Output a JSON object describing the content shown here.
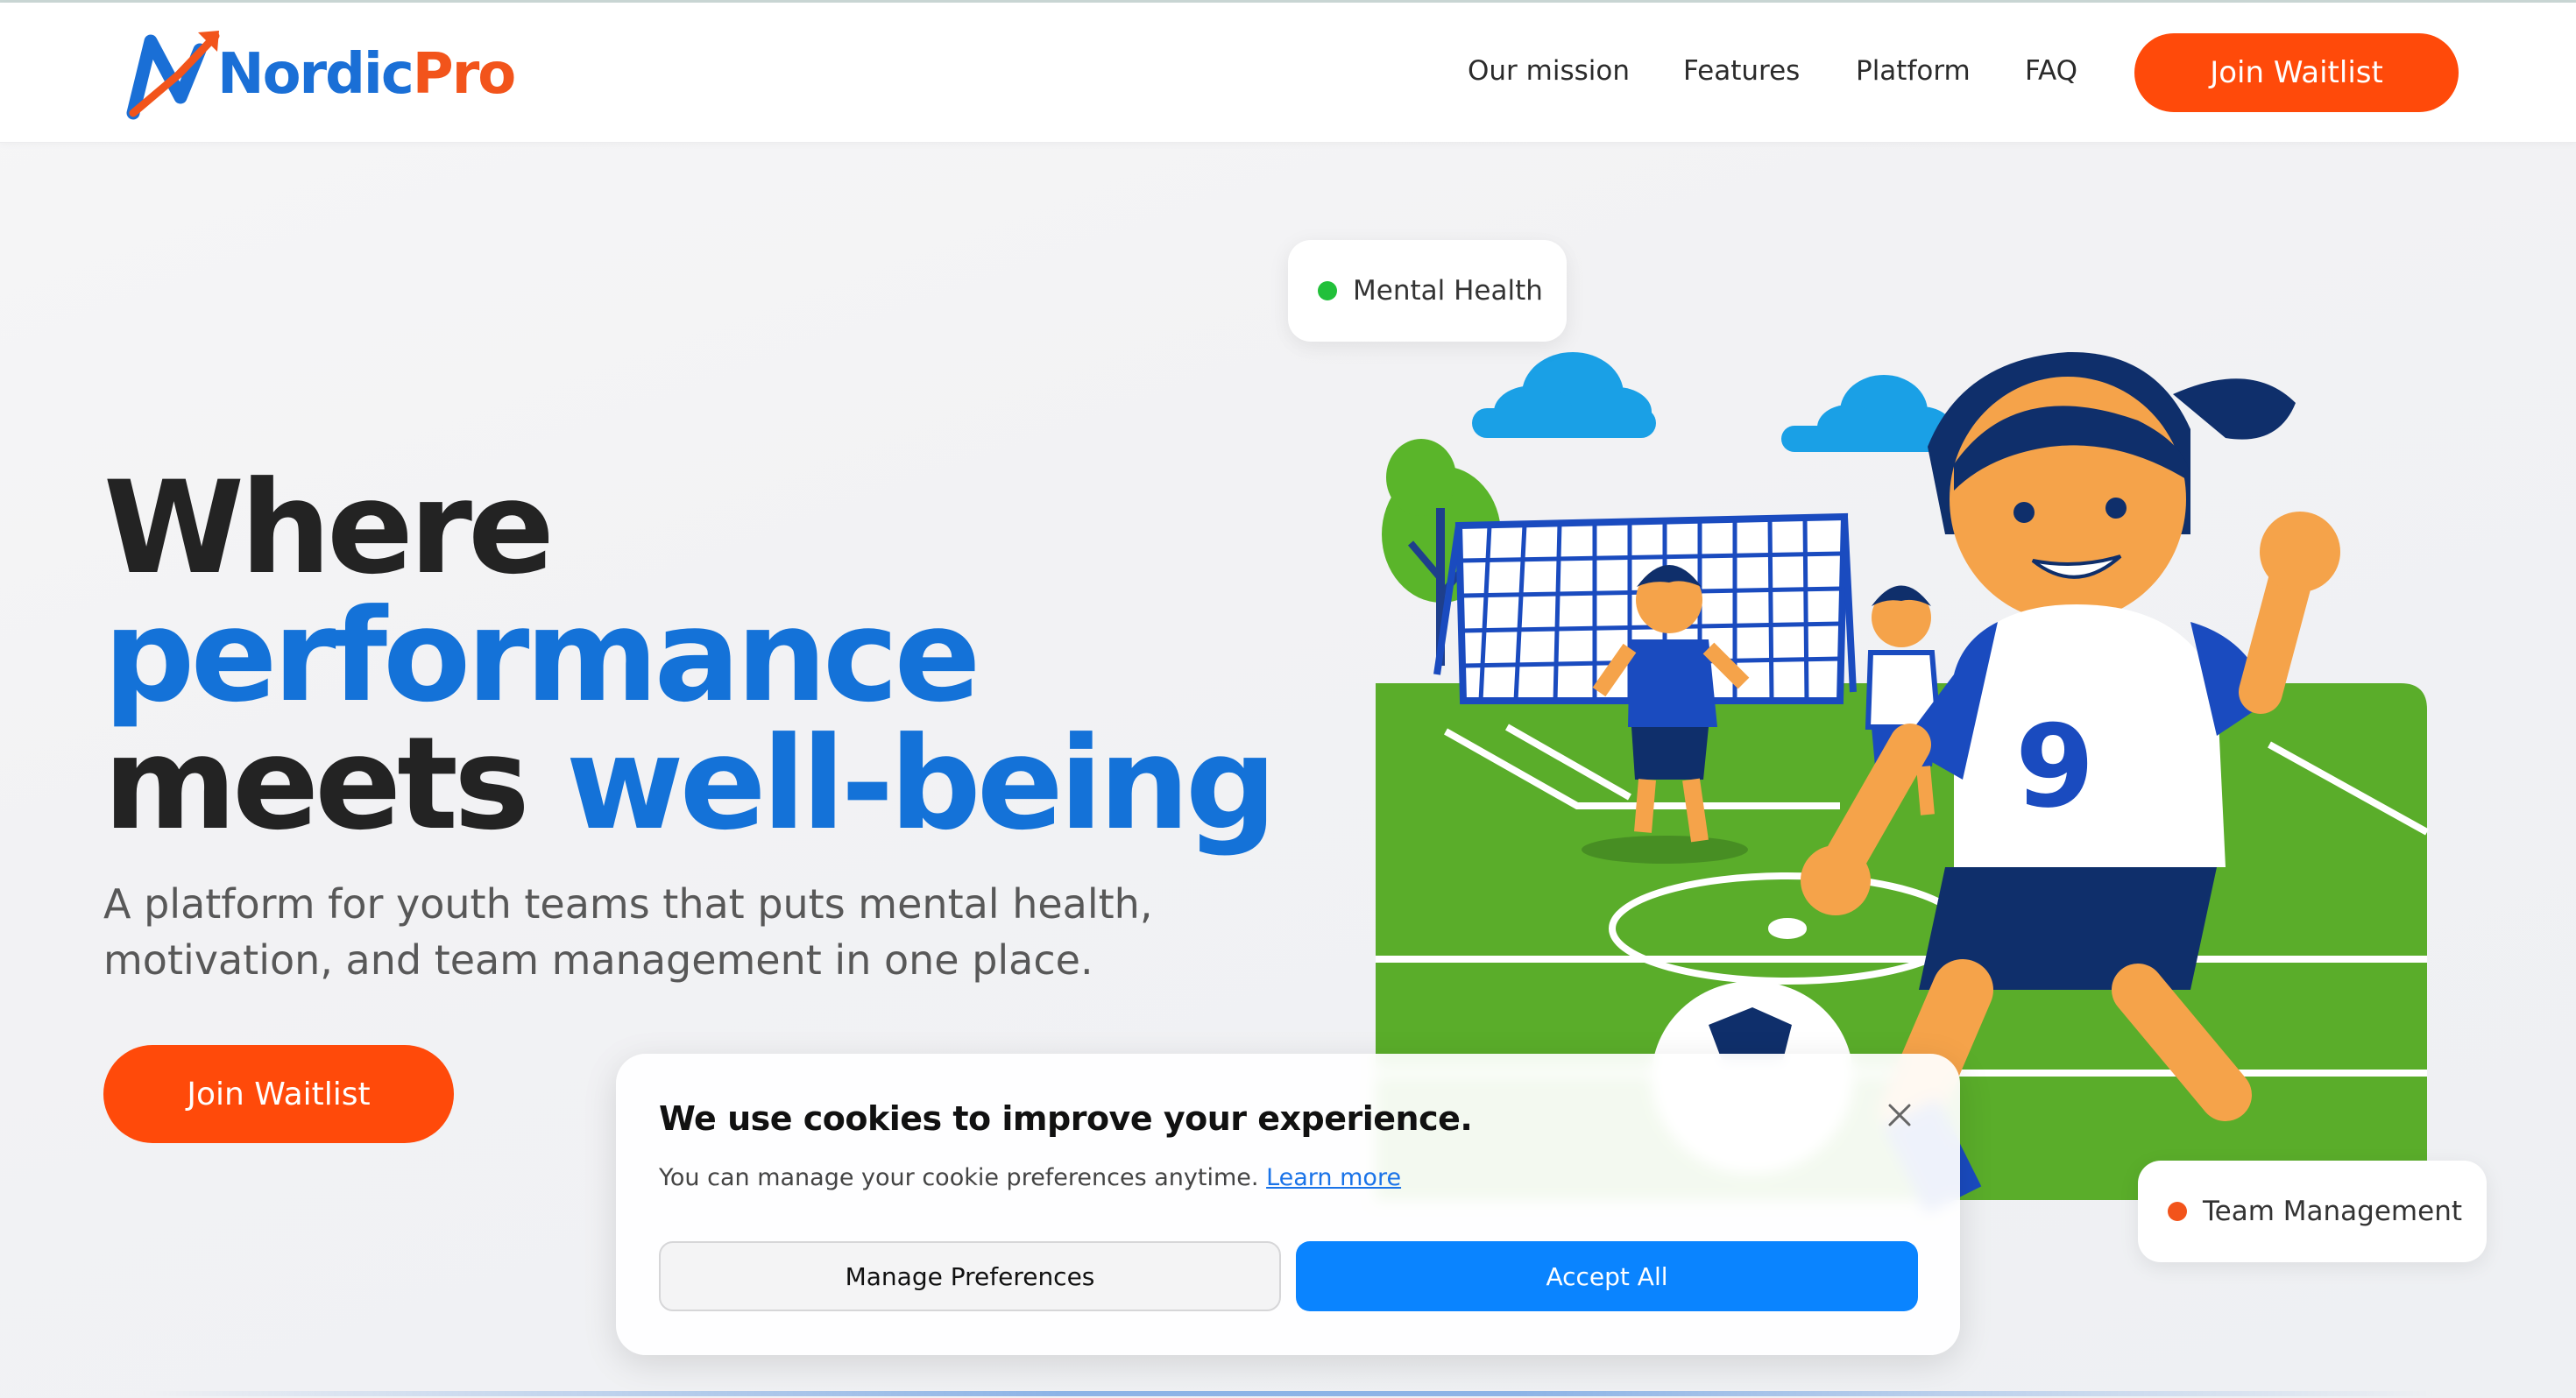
{
  "header": {
    "logo_text_a": "Nordic",
    "logo_text_b": "Pro",
    "nav": [
      "Our mission",
      "Features",
      "Platform",
      "FAQ"
    ],
    "cta_label": "Join Waitlist"
  },
  "hero": {
    "title_line1": "Where",
    "title_line2": "performance",
    "title_line3a": "meets ",
    "title_line3b": "well-being",
    "subtitle": "A platform for youth teams that puts mental health, motivation, and team management in one place.",
    "cta_label": "Join Waitlist"
  },
  "illustration": {
    "pill_mental": "Mental Health",
    "pill_team": "Team Management",
    "jersey_number": "9"
  },
  "cookie": {
    "title": "We use cookies to improve your experience.",
    "text": "You can manage your cookie preferences anytime.",
    "link": "Learn more",
    "manage_label": "Manage Preferences",
    "accept_label": "Accept All"
  },
  "colors": {
    "brand_orange": "#ff4a0a",
    "brand_blue": "#1472d8",
    "accept_blue": "#0a84ff",
    "mental_dot": "#22c03a",
    "team_dot": "#f2541b"
  }
}
